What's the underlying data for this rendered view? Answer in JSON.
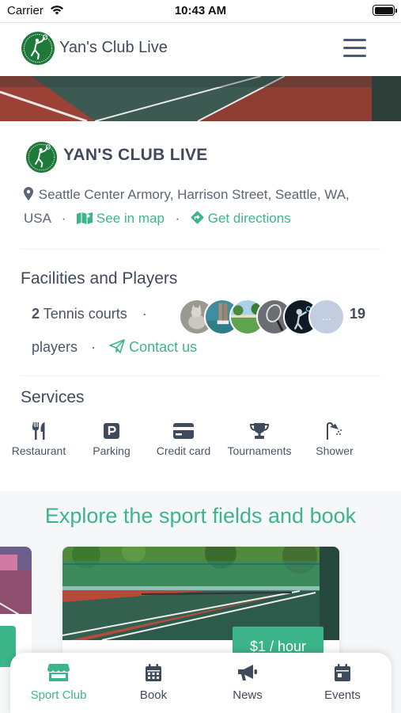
{
  "status_bar": {
    "carrier": "Carrier",
    "time": "10:43 AM"
  },
  "header": {
    "title": "Yan's Club Live"
  },
  "club": {
    "name": "YAN'S CLUB LIVE",
    "address_line1": "Seattle Center Armory, Harrison Street, Seattle, WA,",
    "address_line2": "USA",
    "see_in_map": "See in map",
    "get_directions": "Get directions"
  },
  "facilities": {
    "title": "Facilities and Players",
    "courts_count": "2",
    "courts_label": "Tennis courts",
    "more_avatar": "...",
    "players_count": "19",
    "players_label": "players",
    "contact": "Contact us"
  },
  "services": {
    "title": "Services",
    "items": [
      {
        "label": "Restaurant",
        "icon": "utensils-icon"
      },
      {
        "label": "Parking",
        "icon": "parking-icon"
      },
      {
        "label": "Credit card",
        "icon": "credit-card-icon"
      },
      {
        "label": "Tournaments",
        "icon": "trophy-icon"
      },
      {
        "label": "Shower",
        "icon": "shower-icon"
      }
    ]
  },
  "explore": {
    "title": "Explore the sport fields and book",
    "price": "$1 / hour"
  },
  "tabs": [
    {
      "label": "Sport Club",
      "icon": "store-icon",
      "active": true
    },
    {
      "label": "Book",
      "icon": "calendar-icon",
      "active": false
    },
    {
      "label": "News",
      "icon": "megaphone-icon",
      "active": false
    },
    {
      "label": "Events",
      "icon": "calendar-event-icon",
      "active": false
    }
  ],
  "colors": {
    "accent": "#3db58b",
    "text": "#3f4a5c",
    "logo": "#1f7a3a"
  }
}
